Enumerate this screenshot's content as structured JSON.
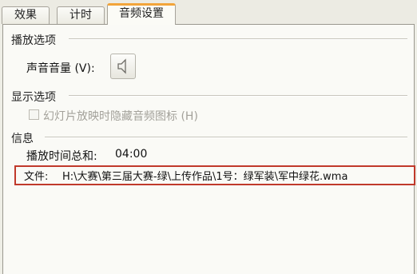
{
  "tabs": [
    {
      "label": "效果"
    },
    {
      "label": "计时"
    },
    {
      "label": "音频设置"
    }
  ],
  "playback": {
    "section_label": "播放选项",
    "volume_label": "声音音量 (V):",
    "volume_icon": "speaker-icon"
  },
  "display": {
    "section_label": "显示选项",
    "hide_icon_label": "幻灯片放映时隐藏音频图标 (H)",
    "hide_icon_checked": false
  },
  "info": {
    "section_label": "信息",
    "total_time_label": "播放时间总和:",
    "total_time_value": "04:00",
    "file_label": "文件:",
    "file_path": "H:\\大赛\\第三届大赛-绿\\上传作品\\1号：绿军装\\军中绿花.wma"
  },
  "colors": {
    "active_tab_accent": "#f2a43a",
    "highlight_border": "#c0392b"
  }
}
